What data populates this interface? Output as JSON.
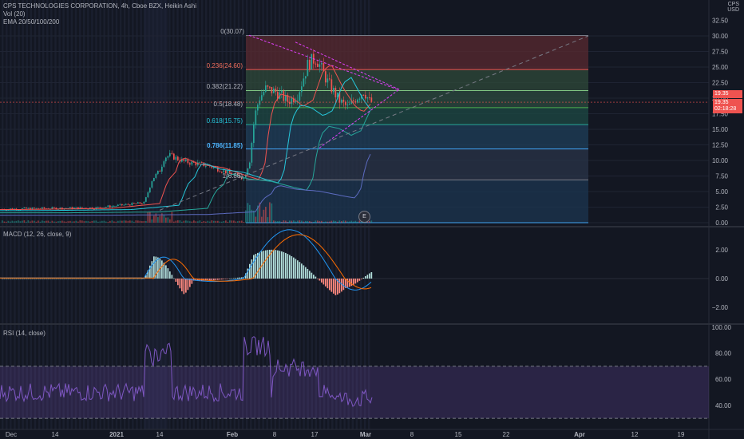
{
  "header": {
    "symbol_line": "CPS TECHNOLOGIES CORPORATION, 4h, Cboe BZX, Heikin Ashi",
    "volume_label": "Vol (20)",
    "ema_label": "EMA 20/50/100/200"
  },
  "currency": {
    "top": "CPS",
    "bottom": "USD"
  },
  "price_axis": {
    "ticks": [
      "32.50",
      "30.00",
      "27.50",
      "25.00",
      "22.50",
      "20.00",
      "17.50",
      "15.00",
      "12.50",
      "10.00",
      "7.50",
      "5.00",
      "2.50",
      "0.00"
    ]
  },
  "price_tag": {
    "price": "19.35",
    "alt_price": "19.35",
    "countdown": "02:18:28"
  },
  "fib_levels": [
    {
      "label": "0(30.07)",
      "color": "#b2b5be"
    },
    {
      "label": "0.236(24.60)",
      "color": "#ef6c5a"
    },
    {
      "label": "0.382(21.22)",
      "color": "#b2b5be"
    },
    {
      "label": "0.5(18.48)",
      "color": "#b2b5be"
    },
    {
      "label": "0.618(15.75)",
      "color": "#26c6da"
    },
    {
      "label": "0.786(11.85)",
      "color": "#4db6ff"
    },
    {
      "label": "1(6.88)",
      "color": "#b2b5be"
    }
  ],
  "earnings_badge": "E",
  "macd": {
    "label": "MACD (12, 26, close, 9)",
    "ticks": [
      "2.00",
      "0.00",
      "−2.00"
    ]
  },
  "rsi": {
    "label": "RSI (14, close)",
    "ticks": [
      "100.00",
      "80.00",
      "60.00",
      "40.00"
    ]
  },
  "time_axis": {
    "ticks": [
      "Dec",
      "14",
      "2021",
      "14",
      "Feb",
      "8",
      "17",
      "Mar",
      "8",
      "15",
      "22",
      "Apr",
      "12",
      "19"
    ]
  },
  "colors": {
    "background": "#131722",
    "bull": "#26a69a",
    "bear": "#ef5350",
    "macd_line": "#2196f3",
    "signal_line": "#ff6d00",
    "rsi_line": "#7e57c2"
  }
}
